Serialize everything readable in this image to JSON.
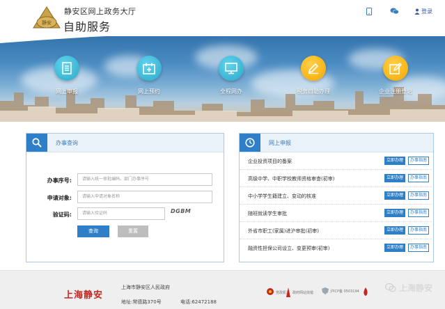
{
  "header": {
    "title_main": "静安区网上政务大厅",
    "title_sub": "自助服务",
    "logo_text": "静安",
    "login_label": "登录"
  },
  "functions": [
    {
      "label": "网上申报",
      "icon": "document-icon",
      "color": "#2aa9c9"
    },
    {
      "label": "网上预约",
      "icon": "calendar-icon",
      "color": "#2aa9c9"
    },
    {
      "label": "全程网办",
      "icon": "monitor-icon",
      "color": "#2aa9c9"
    },
    {
      "label": "税务自助办理",
      "icon": "pen-icon",
      "color": "#f5a800"
    },
    {
      "label": "企业注册登记",
      "icon": "register-icon",
      "color": "#f5a800"
    }
  ],
  "query_panel": {
    "title": "办事查询",
    "fields": [
      {
        "label": "办事序号:",
        "placeholder": "请输入统一审批编码、部门办事序号"
      },
      {
        "label": "申请对象:",
        "placeholder": "请输入申请对象名称"
      },
      {
        "label": "验证码:",
        "placeholder": "请输入验证码"
      }
    ],
    "captcha": "DGBM",
    "query_btn": "查询",
    "reset_btn": "重置"
  },
  "apply_panel": {
    "title": "网上申报",
    "apply_label": "立即办理",
    "guide_label": "办事指南",
    "items": [
      "企业投资项目的备案",
      "高级中学、中职学校教师资格审查(初审)",
      "中小学学生籍建立、变动的核准",
      "随班就读学生审批",
      "外省市职工(家属)进沪审批(初审)",
      "融资性担保公司设立、变更预审(初审)"
    ]
  },
  "footer": {
    "brand": "上海静安",
    "gov": "上海市静安区人民政府",
    "address": "地址:常德路370号",
    "tel": "电话:62472188",
    "badges": [
      "党政机关",
      "政府网站找错",
      "沪ICP备 0503194"
    ],
    "watermark": "上海静安"
  },
  "colors": {
    "accent": "#2f7fc8",
    "teal": "#2aa9c9",
    "orange": "#f5a800",
    "brand_red": "#c6261f"
  }
}
